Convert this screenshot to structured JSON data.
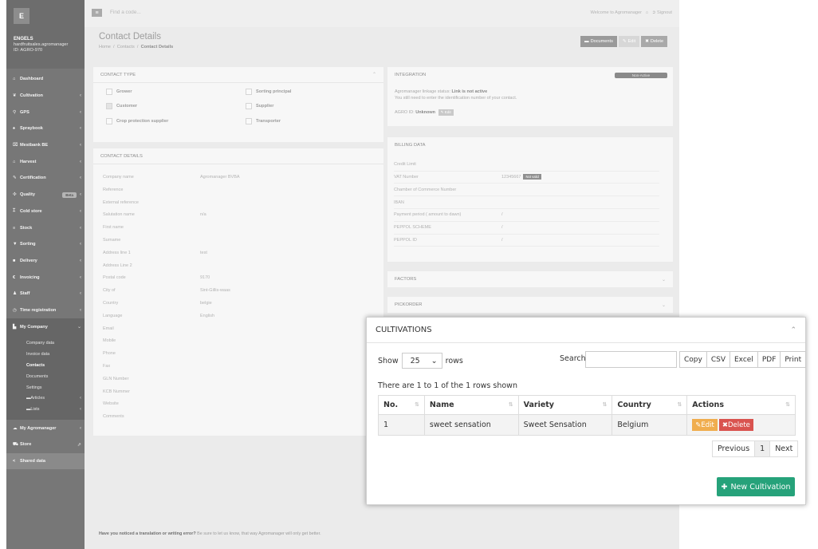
{
  "sidebar": {
    "logo_letter": "E",
    "user_name": "ENGELS",
    "user_email": "hardfruitsales.agromanager",
    "user_id": "ID: AGRO-970",
    "items": [
      {
        "label": "Dashboard",
        "icon": "home-icon",
        "glyph": "⌂",
        "chevron": ""
      },
      {
        "label": "Cultivation",
        "icon": "leaf-icon",
        "glyph": "❦",
        "chevron": "‹"
      },
      {
        "label": "GPS",
        "icon": "map-pin-icon",
        "glyph": "⚲",
        "chevron": "‹"
      },
      {
        "label": "Spraybook",
        "icon": "spray-icon",
        "glyph": "♠",
        "chevron": "‹"
      },
      {
        "label": "Mestbank BE",
        "icon": "bank-icon",
        "glyph": "⌧",
        "chevron": "‹"
      },
      {
        "label": "Harvest",
        "icon": "basket-icon",
        "glyph": "⌂",
        "chevron": "‹"
      },
      {
        "label": "Certification",
        "icon": "certificate-icon",
        "glyph": "✎",
        "chevron": "‹"
      },
      {
        "label": "Quality",
        "icon": "quality-icon",
        "glyph": "✣",
        "chevron": "‹",
        "badge": "Beta"
      },
      {
        "label": "Cold store",
        "icon": "thermometer-icon",
        "glyph": "⌶",
        "chevron": "‹"
      },
      {
        "label": "Stock",
        "icon": "stock-icon",
        "glyph": "≡",
        "chevron": "‹"
      },
      {
        "label": "Sorting",
        "icon": "filter-icon",
        "glyph": "▼",
        "chevron": "‹"
      },
      {
        "label": "Delivery",
        "icon": "truck-icon",
        "glyph": "■",
        "chevron": "‹"
      },
      {
        "label": "Invoicing",
        "icon": "euro-icon",
        "glyph": "€",
        "chevron": "‹"
      },
      {
        "label": "Staff",
        "icon": "user-icon",
        "glyph": "♟",
        "chevron": "‹"
      },
      {
        "label": "Time registration",
        "icon": "clock-icon",
        "glyph": "◷",
        "chevron": "‹"
      }
    ],
    "my_company": {
      "label": "My Company",
      "chevron": "⌄",
      "sub_items": [
        "Company data",
        "Invoice data",
        "Contacts",
        "Documents",
        "Settings"
      ],
      "deep_items": [
        "Articles",
        "Lists"
      ]
    },
    "tail_items": [
      {
        "label": "My Agromanager",
        "icon": "cloud-icon",
        "glyph": "☁",
        "chevron": "‹"
      },
      {
        "label": "Store",
        "icon": "cart-icon",
        "glyph": "⛟",
        "chevron": "⇗"
      },
      {
        "label": "Shared data",
        "icon": "share-icon",
        "glyph": "<",
        "chevron": ""
      }
    ]
  },
  "topbar": {
    "menu_glyph": "≡",
    "search_placeholder": "Find a code...",
    "welcome": "Welcome to Agromanager",
    "signout": "Signout"
  },
  "page": {
    "title": "Contact Details",
    "breadcrumb": [
      "Home",
      "Contacts",
      "Contact Details"
    ],
    "buttons": {
      "documents": "Documents",
      "edit": "Edit",
      "delete": "Delete"
    }
  },
  "contact_type": {
    "title": "CONTACT TYPE",
    "options": [
      {
        "label": "Grower",
        "checked": false
      },
      {
        "label": "Customer",
        "checked": true
      },
      {
        "label": "Crop protection supplier",
        "checked": false
      },
      {
        "label": "Sorting principal",
        "checked": false
      },
      {
        "label": "Supplier",
        "checked": false
      },
      {
        "label": "Transporter",
        "checked": false
      }
    ]
  },
  "contact_details": {
    "title": "CONTACT DETAILS",
    "rows": [
      {
        "label": "Company name",
        "value": "Agromanager BVBA"
      },
      {
        "label": "Reference",
        "value": ""
      },
      {
        "label": "External reference",
        "value": ""
      },
      {
        "label": "Salutation name",
        "value": "n/a"
      },
      {
        "label": "First name",
        "value": ""
      },
      {
        "label": "Surname",
        "value": ""
      },
      {
        "label": "Address line 1",
        "value": "test"
      },
      {
        "label": "Address Line 2",
        "value": ""
      },
      {
        "label": "Postal code",
        "value": "9170"
      },
      {
        "label": "City of",
        "value": "Sint-Gillis-waas"
      },
      {
        "label": "Country",
        "value": "belgie"
      },
      {
        "label": "Language",
        "value": "English"
      },
      {
        "label": "Email",
        "value": ""
      },
      {
        "label": "Mobile",
        "value": ""
      },
      {
        "label": "Phone",
        "value": ""
      },
      {
        "label": "Fax",
        "value": ""
      },
      {
        "label": "GLN Number",
        "value": ""
      },
      {
        "label": "KCB Nummer",
        "value": ""
      },
      {
        "label": "Website",
        "value": ""
      },
      {
        "label": "Comments",
        "value": ""
      }
    ]
  },
  "integration": {
    "title": "INTEGRATION",
    "status_badge": "Non-Active",
    "line1_prefix": "Agromanager linkage status: ",
    "line1_strong": "Link is not active",
    "line2": "You still need to enter the identification number of your contact.",
    "agro_id_label": "AGRO ID: ",
    "agro_id_value": "Unknown",
    "edit": "Edit"
  },
  "billing": {
    "title": "BILLING DATA",
    "rows": [
      {
        "label": "Credit Limit",
        "value": "",
        "badge": ""
      },
      {
        "label": "VAT Number",
        "value": "12345667",
        "badge": "Not valid"
      },
      {
        "label": "Chamber of Commerce Number",
        "value": "",
        "badge": ""
      },
      {
        "label": "IBAN",
        "value": "",
        "badge": ""
      },
      {
        "label": "Payment period ( amount to dawn)",
        "value": "/",
        "badge": ""
      },
      {
        "label": "PEPPOL SCHEME",
        "value": "/",
        "badge": ""
      },
      {
        "label": "PEPPOL ID",
        "value": "/",
        "badge": ""
      }
    ]
  },
  "factors": {
    "title": "FACTORS"
  },
  "pickorder": {
    "title": "PICKORDER"
  },
  "footer": {
    "strong": "Have you noticed a translation or writing error?",
    "text": " Be sure to let us know, that way Agromanager will only get better."
  },
  "cultivations": {
    "title": "CULTIVATIONS",
    "show_label": "Show",
    "rows_per_page": "25",
    "rows_label": "rows",
    "search_label": "Search",
    "export_buttons": [
      "Copy",
      "CSV",
      "Excel",
      "PDF",
      "Print"
    ],
    "info": "There are 1 to 1 of the 1 rows shown",
    "columns": [
      "No.",
      "Name",
      "Variety",
      "Country",
      "Actions"
    ],
    "rows": [
      {
        "no": "1",
        "name": "sweet sensation",
        "variety": "Sweet Sensation",
        "country": "Belgium"
      }
    ],
    "row_edit": "Edit",
    "row_delete": "Delete",
    "pager": {
      "previous": "Previous",
      "page": "1",
      "next": "Next"
    },
    "new_button": "New Cultivation"
  },
  "colors": {
    "sidebar": "#777777",
    "new_button": "#26a27a",
    "edit_button": "#f0ad4e",
    "delete_button": "#d9534f"
  }
}
